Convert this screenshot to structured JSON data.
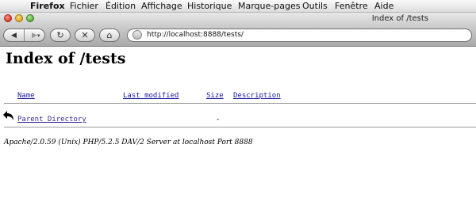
{
  "menubar": {
    "app": "Firefox",
    "items": [
      "Fichier",
      "Édition",
      "Affichage",
      "Historique",
      "Marque-pages",
      "Outils",
      "Fenêtre",
      "Aide"
    ]
  },
  "window": {
    "title": "Index of /tests"
  },
  "toolbar": {
    "url": "http://localhost:8888/tests/"
  },
  "page": {
    "heading": "Index of /tests",
    "columns": {
      "name": "Name",
      "modified": "Last modified",
      "size": "Size",
      "description": "Description"
    },
    "rows": [
      {
        "name": "Parent Directory",
        "modified": "",
        "size": "-",
        "description": "",
        "icon": "back-arrow-icon"
      }
    ],
    "address": "Apache/2.0.59 (Unix) PHP/5.2.5 DAV/2 Server at localhost Port 8888"
  }
}
